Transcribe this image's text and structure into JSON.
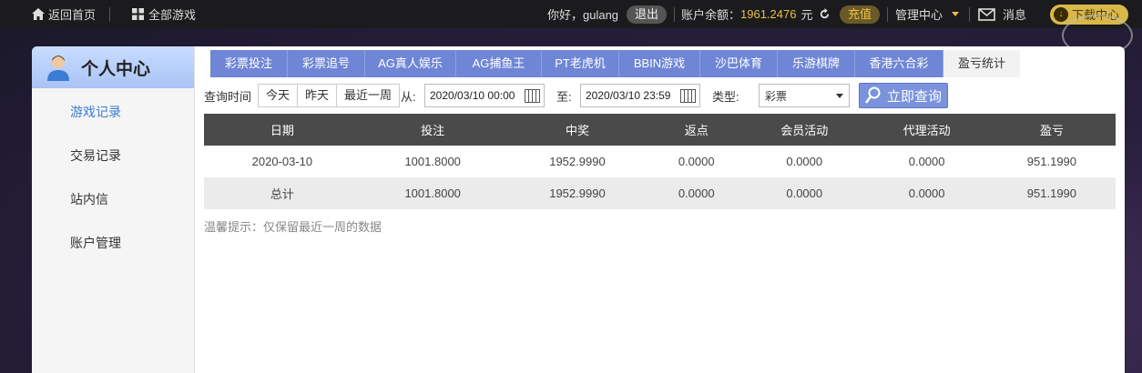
{
  "topbar": {
    "home": "返回首页",
    "all_games": "全部游戏",
    "greeting": "你好，gulang",
    "logout": "退出",
    "balance_label": "账户余额：",
    "balance_value": "1961.2476",
    "currency": "元",
    "recharge": "充值",
    "admin_center": "管理中心",
    "messages": "消息",
    "download": "下载中心"
  },
  "sidebar": {
    "title": "个人中心",
    "items": [
      {
        "label": "游戏记录"
      },
      {
        "label": "交易记录"
      },
      {
        "label": "站内信"
      },
      {
        "label": "账户管理"
      }
    ]
  },
  "tabs": [
    {
      "label": "彩票投注"
    },
    {
      "label": "彩票追号"
    },
    {
      "label": "AG真人娱乐"
    },
    {
      "label": "AG捕鱼王"
    },
    {
      "label": "PT老虎机"
    },
    {
      "label": "BBIN游戏"
    },
    {
      "label": "沙巴体育"
    },
    {
      "label": "乐游棋牌"
    },
    {
      "label": "香港六合彩"
    },
    {
      "label": "盈亏统计"
    }
  ],
  "filter": {
    "query_time_label": "查询时间",
    "today": "今天",
    "yesterday": "昨天",
    "recent_week": "最近一周",
    "from_label": "从:",
    "from_value": "2020/03/10 00:00",
    "to_label": "至:",
    "to_value": "2020/03/10 23:59",
    "type_label": "类型:",
    "type_value": "彩票",
    "query_button": "立即查询"
  },
  "table": {
    "headers": [
      "日期",
      "投注",
      "中奖",
      "返点",
      "会员活动",
      "代理活动",
      "盈亏"
    ],
    "rows": [
      [
        "2020-03-10",
        "1001.8000",
        "1952.9990",
        "0.0000",
        "0.0000",
        "0.0000",
        "951.1990"
      ],
      [
        "总计",
        "1001.8000",
        "1952.9990",
        "0.0000",
        "0.0000",
        "0.0000",
        "951.1990"
      ]
    ]
  },
  "tip": "温馨提示：仅保留最近一周的数据",
  "colors": {
    "tab_bg": "#6f86d6",
    "accent_blue": "#3a7bd5",
    "balance": "#e8c040",
    "table_header": "#4a4a4a"
  }
}
